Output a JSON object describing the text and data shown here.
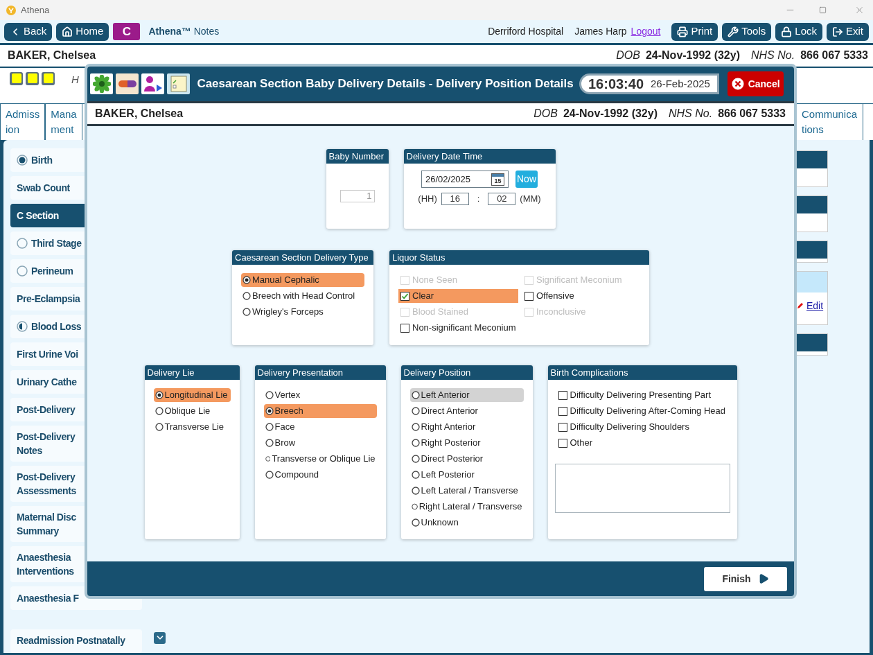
{
  "window": {
    "title": "Athena"
  },
  "toolbar": {
    "left_buttons": [
      {
        "label": "Back"
      },
      {
        "label": "Home"
      }
    ],
    "badge": "C",
    "app_title": "**Athena™** Notes",
    "hospital": "Derriford Hospital",
    "user": "James Harp",
    "logout": "Logout",
    "right_buttons": [
      {
        "label": "Print"
      },
      {
        "label": "Tools"
      },
      {
        "label": "Lock"
      },
      {
        "label": "Exit"
      }
    ]
  },
  "patient": {
    "name": "BAKER, Chelsea",
    "dob_label": "DOB",
    "dob": "24-Nov-1992 (32y)",
    "nhs_label": "NHS No.",
    "nhs": "866 067 5333"
  },
  "alert_text": "H",
  "tabs": [
    {
      "lines": [
        "Admiss",
        "ion"
      ]
    },
    {
      "lines": [
        "Mana",
        "ment"
      ]
    },
    {
      "lines": [
        "Communica",
        "tions"
      ]
    }
  ],
  "sidebar": {
    "items": [
      {
        "label": "Birth",
        "kind": "done",
        "selected": false
      },
      {
        "label": "Swab Count",
        "kind": "none",
        "selected": false
      },
      {
        "label": "C Section",
        "kind": "none",
        "selected": true
      },
      {
        "label": "Third Stage",
        "kind": "empty",
        "selected": false
      },
      {
        "label": "Perineum",
        "kind": "empty",
        "selected": false
      },
      {
        "label": "Pre-Eclampsia",
        "kind": "none",
        "selected": false
      },
      {
        "label": "Blood Loss",
        "kind": "partial",
        "selected": false
      },
      {
        "label": "First Urine Voi",
        "kind": "none",
        "selected": false
      },
      {
        "label": "Urinary Cathe",
        "kind": "none",
        "selected": false
      },
      {
        "label": "Post-Delivery",
        "kind": "none",
        "selected": false
      },
      {
        "label": "Post-Delivery Notes",
        "kind": "none",
        "selected": false
      },
      {
        "label": "Post-Delivery Assessments",
        "kind": "none",
        "selected": false
      },
      {
        "label": "Maternal Disc Summary",
        "kind": "none",
        "selected": false
      },
      {
        "label": "Anaesthesia Interventions",
        "kind": "none",
        "selected": false
      },
      {
        "label": "Anaesthesia F",
        "kind": "none",
        "selected": false
      }
    ],
    "bottom_item": {
      "label": "Readmission Postnatally",
      "selected": false
    }
  },
  "right_panels": [
    {
      "kind": "header"
    },
    {
      "kind": "header"
    },
    {
      "kind": "short"
    },
    {
      "kind": "edit",
      "link": "Edit"
    },
    {
      "kind": "short"
    }
  ],
  "dialog": {
    "title": "Caesarean Section Baby Delivery Details - Delivery Position Details",
    "time": "16:03:40",
    "date": "26-Feb-2025",
    "cancel": "Cancel",
    "patient": {
      "name": "BAKER, Chelsea",
      "dob_label": "DOB",
      "dob": "24-Nov-1992 (32y)",
      "nhs_label": "NHS No.",
      "nhs": "866 067 5333"
    },
    "baby_number": {
      "title": "Baby Number",
      "value": "1",
      "disabled": true
    },
    "delivery_date_time": {
      "title": "Delivery Date Time",
      "date": "26/02/2025",
      "calendar_day": "15",
      "now": "Now",
      "hh_label": "(HH)",
      "hh": "16",
      "separator": ":",
      "mm": "02",
      "mm_label": "(MM)"
    },
    "delivery_type": {
      "title": "Caesarean Section Delivery Type",
      "options": [
        {
          "label": "Manual Cephalic",
          "selected": true
        },
        {
          "label": "Breech with Head Control",
          "selected": false
        },
        {
          "label": "Wrigley's Forceps",
          "selected": false
        }
      ]
    },
    "liquor_status": {
      "title": "Liquor Status",
      "options": [
        {
          "label": "None Seen",
          "checked": false,
          "disabled": true
        },
        {
          "label": "Significant Meconium",
          "checked": false,
          "disabled": true
        },
        {
          "label": "Clear",
          "checked": true,
          "disabled": false
        },
        {
          "label": "Offensive",
          "checked": false,
          "disabled": false
        },
        {
          "label": "Blood Stained",
          "checked": false,
          "disabled": true
        },
        {
          "label": "Inconclusive",
          "checked": false,
          "disabled": true
        },
        {
          "label": "Non-significant Meconium",
          "checked": false,
          "disabled": false
        }
      ]
    },
    "delivery_lie": {
      "title": "Delivery Lie",
      "options": [
        {
          "label": "Longitudinal Lie",
          "selected": true
        },
        {
          "label": "Oblique Lie",
          "selected": false
        },
        {
          "label": "Transverse Lie",
          "selected": false
        }
      ]
    },
    "delivery_presentation": {
      "title": "Delivery Presentation",
      "options": [
        {
          "label": "Vertex",
          "selected": false
        },
        {
          "label": "Breech",
          "selected": true
        },
        {
          "label": "Face",
          "selected": false
        },
        {
          "label": "Brow",
          "selected": false
        },
        {
          "label": "Transverse or Oblique Lie",
          "selected": false
        },
        {
          "label": "Compound",
          "selected": false
        }
      ]
    },
    "delivery_position": {
      "title": "Delivery Position",
      "options": [
        {
          "label": "Left Anterior",
          "selected": false,
          "highlighted": true
        },
        {
          "label": "Direct Anterior",
          "selected": false,
          "highlighted": false
        },
        {
          "label": "Right Anterior",
          "selected": false,
          "highlighted": false
        },
        {
          "label": "Right Posterior",
          "selected": false,
          "highlighted": false
        },
        {
          "label": "Direct Posterior",
          "selected": false,
          "highlighted": false
        },
        {
          "label": "Left Posterior",
          "selected": false,
          "highlighted": false
        },
        {
          "label": "Left Lateral / Transverse",
          "selected": false,
          "highlighted": false
        },
        {
          "label": "Right Lateral / Transverse",
          "selected": false,
          "highlighted": false
        },
        {
          "label": "Unknown",
          "selected": false,
          "highlighted": false
        }
      ]
    },
    "birth_complications": {
      "title": "Birth Complications",
      "options": [
        {
          "label": "Difficulty Delivering Presenting Part",
          "checked": false,
          "disabled": false
        },
        {
          "label": "Difficulty Delivering After-Coming Head",
          "checked": false,
          "disabled": false
        },
        {
          "label": "Difficulty Delivering Shoulders",
          "checked": false,
          "disabled": false
        },
        {
          "label": "Other",
          "checked": false,
          "disabled": false
        }
      ]
    },
    "finish": "Finish"
  }
}
